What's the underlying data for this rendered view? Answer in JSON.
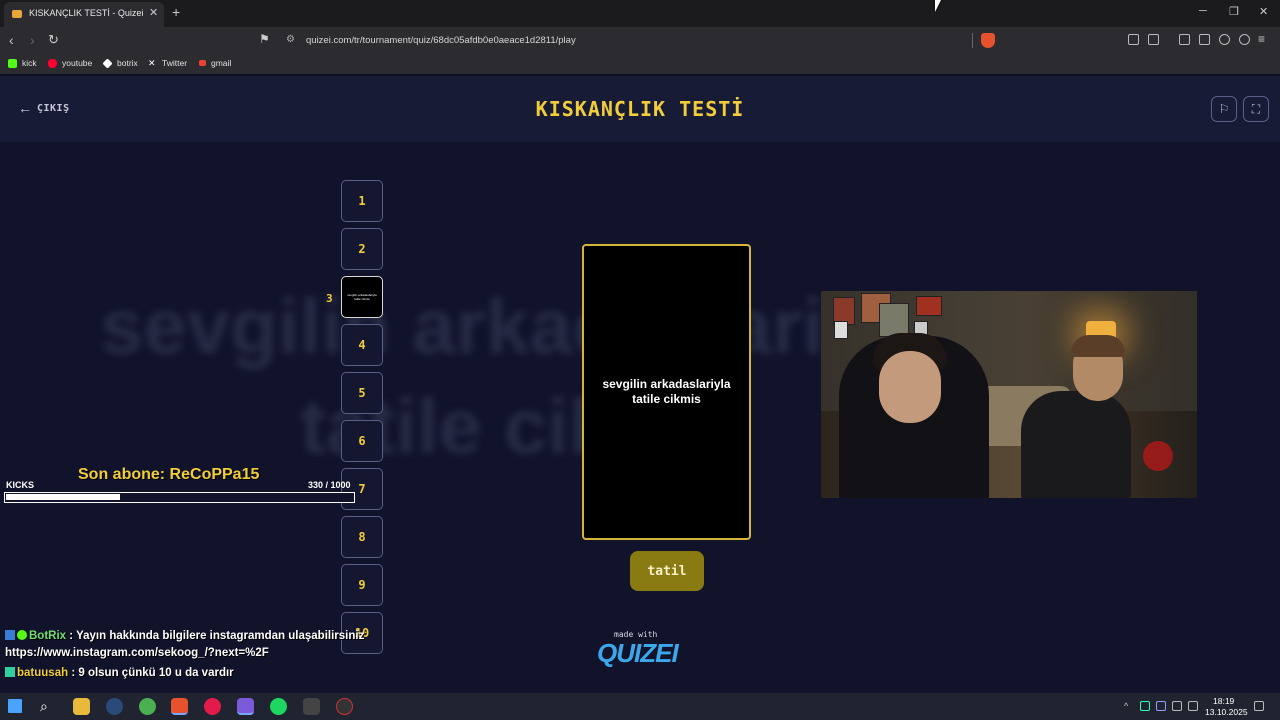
{
  "browser": {
    "tab_title": "KISKANÇLIK TESTİ - Quizei",
    "tab_close": "✕",
    "new_tab": "+",
    "url": "quizei.com/tr/tournament/quiz/68dc05afdb0e0aeace1d2811/play",
    "bookmarks": [
      {
        "label": "kick",
        "color": "#53fc18"
      },
      {
        "label": "youtube",
        "color": "#ff0033"
      },
      {
        "label": "botrix",
        "color": "#ffffff"
      },
      {
        "label": "Twitter",
        "color": "#ffffff"
      },
      {
        "label": "gmail",
        "color": "#ea4335"
      }
    ]
  },
  "header": {
    "back_label": "ÇIKIŞ",
    "title": "KISKANÇLIK TESTİ"
  },
  "background_text": [
    "sevgilin arkadaslariyla",
    "tatile cikmis"
  ],
  "numbers": [
    "1",
    "2",
    "3",
    "4",
    "5",
    "6",
    "7",
    "8",
    "9",
    "10"
  ],
  "active_index": 2,
  "active_indicator": "3",
  "active_mini_text": "sevgilin arkadaslariyla tatile cikmis",
  "card": {
    "text": "sevgilin arkadaslariyla tatile cikmis"
  },
  "answer_button": "tatil",
  "branding": {
    "made_with": "made with",
    "logo": "QUIZEI"
  },
  "overlay": {
    "son_abone": "Son abone: ReCoPPa15",
    "kicks_label": "KICKS",
    "kicks_count": "330  / 1000",
    "kicks_progress": 0.33
  },
  "chat": [
    {
      "user": "BotRix",
      "message": ": Yayın hakkında bilgilere instagramdan ulaşabilirsiniz"
    },
    {
      "user": "",
      "message": "https://www.instagram.com/sekoog_/?next=%2F"
    },
    {
      "user": "batuusah",
      "message": ": 9 olsun çünkü 10 u da vardır"
    }
  ],
  "taskbar": {
    "time": "18:19",
    "date": "13.10.2025"
  },
  "colors": {
    "accent": "#f2cd3b",
    "page_bg": "#10132a",
    "header_bg": "#181b36",
    "answer_bg": "#8a7a12",
    "logo": "#3aa8ea"
  }
}
